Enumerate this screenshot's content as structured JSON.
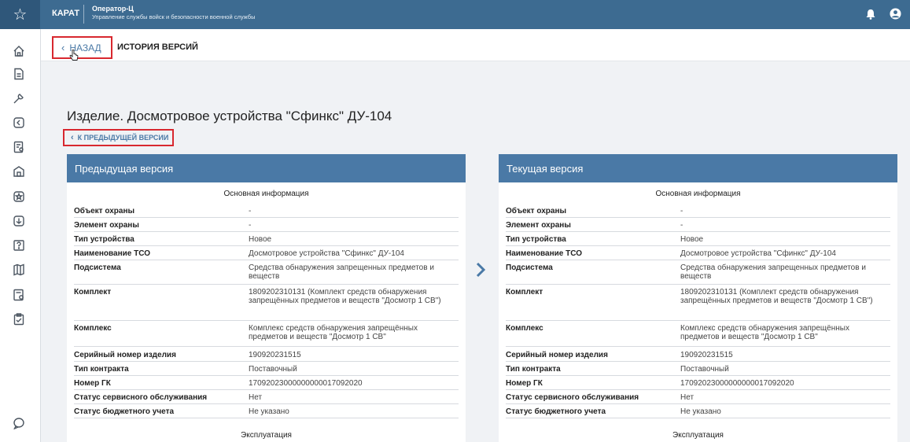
{
  "topbar": {
    "brand": "КАРАТ",
    "operator": "Оператор-Ц",
    "subtitle": "Управление службы войск и безопасности военной службы"
  },
  "sidebar": {
    "icons": [
      "home-icon",
      "document-icon",
      "wrench-icon",
      "triangle-badge-icon",
      "clipboard-user-icon",
      "building-icon",
      "star-badge-icon",
      "download-icon",
      "question-doc-icon",
      "map-icon",
      "settings-doc-icon",
      "clipboard-check-icon",
      "chat-icon"
    ]
  },
  "header": {
    "back_label": "НАЗАД",
    "history_label": "ИСТОРИЯ ВЕРСИЙ"
  },
  "page": {
    "title": "Изделие. Досмотровое устройства \"Сфинкс\" ДУ-104",
    "prev_version_link": "К ПРЕДЫДУЩЕЙ ВЕРСИИ"
  },
  "panels": [
    {
      "heading": "Предыдущая версия",
      "section": "Основная информация",
      "footer_section": "Эксплуатация",
      "rows": [
        {
          "k": "Объект охраны",
          "v": "-"
        },
        {
          "k": "Элемент охраны",
          "v": "-"
        },
        {
          "k": "Тип устройства",
          "v": "Новое"
        },
        {
          "k": "Наименование ТСО",
          "v": "Досмотровое устройства \"Сфинкс\" ДУ-104"
        },
        {
          "k": "Подсистема",
          "v": "Средства обнаружения запрещенных предметов и веществ"
        },
        {
          "k": "Комплект",
          "v": "1809202310131 (Комплект средств обнаружения запрещённых предметов и веществ \"Досмотр 1 СВ\")"
        },
        {
          "k": "Комплекс",
          "v": "Комплекс средств обнаружения запрещённых предметов и веществ \"Досмотр 1 СВ\""
        },
        {
          "k": "Серийный номер изделия",
          "v": "190920231515"
        },
        {
          "k": "Тип контракта",
          "v": "Поставочный"
        },
        {
          "k": "Номер ГК",
          "v": "17092023000000000017092020"
        },
        {
          "k": "Статус сервисного обслуживания",
          "v": "Нет"
        },
        {
          "k": "Статус бюджетного учета",
          "v": "Не указано"
        }
      ]
    },
    {
      "heading": "Текущая версия",
      "section": "Основная информация",
      "footer_section": "Эксплуатация",
      "rows": [
        {
          "k": "Объект охраны",
          "v": "-"
        },
        {
          "k": "Элемент охраны",
          "v": "-"
        },
        {
          "k": "Тип устройства",
          "v": "Новое"
        },
        {
          "k": "Наименование ТСО",
          "v": "Досмотровое устройства \"Сфинкс\" ДУ-104"
        },
        {
          "k": "Подсистема",
          "v": "Средства обнаружения запрещенных предметов и веществ"
        },
        {
          "k": "Комплект",
          "v": "1809202310131 (Комплект средств обнаружения запрещённых предметов и веществ \"Досмотр 1 СВ\")"
        },
        {
          "k": "Комплекс",
          "v": "Комплекс средств обнаружения запрещённых предметов и веществ \"Досмотр 1 СВ\""
        },
        {
          "k": "Серийный номер изделия",
          "v": "190920231515"
        },
        {
          "k": "Тип контракта",
          "v": "Поставочный"
        },
        {
          "k": "Номер ГК",
          "v": "17092023000000000017092020"
        },
        {
          "k": "Статус сервисного обслуживания",
          "v": "Нет"
        },
        {
          "k": "Статус бюджетного учета",
          "v": "Не указано"
        }
      ]
    }
  ],
  "colors": {
    "topbar": "#3d6b91",
    "panel_header": "#4a79a6",
    "highlight": "#d8282f"
  }
}
